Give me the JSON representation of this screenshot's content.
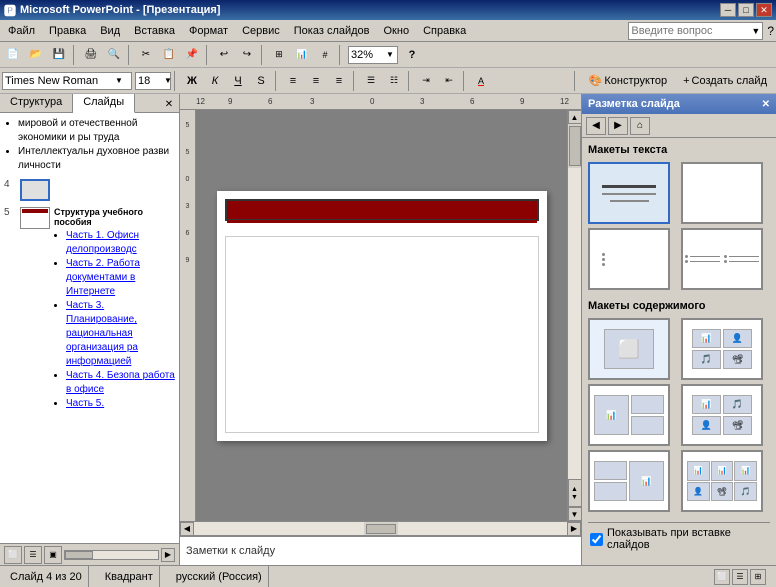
{
  "titlebar": {
    "title": "Microsoft PowerPoint - [Презентация]",
    "icon": "▶",
    "min": "─",
    "max": "□",
    "close": "✕"
  },
  "menubar": {
    "items": [
      "Файл",
      "Правка",
      "Вид",
      "Вставка",
      "Формат",
      "Сервис",
      "Показ слайдов",
      "Окно",
      "Справка"
    ],
    "search_placeholder": "Введите вопрос"
  },
  "formatting_toolbar": {
    "font": "Times New Roman",
    "size": "18",
    "bold": "Ж",
    "italic": "К",
    "underline": "Ч",
    "shadow": "S",
    "align_left": "≡",
    "align_center": "≡",
    "align_right": "≡",
    "design_label": "Конструктор",
    "new_slide_label": "Создать слайд"
  },
  "sidebar": {
    "tab_structure": "Структура",
    "tab_slides": "Слайды",
    "slides": [
      {
        "num": "4",
        "text": ""
      },
      {
        "num": "5",
        "text": "Структура учебного пособия"
      }
    ],
    "content_items": [
      "мировой и отечественной экономики и ры труда",
      "Интеллектуальн духовное разви личности"
    ],
    "bullet_items": [
      "Часть 1. Офисн делопроизводс",
      "Часть 2. Работа документами в Интернете",
      "Часть 3. Планирование, рациональная организация ра информацией",
      "Часть 4. Безопа работа в офисе",
      "Часть 5."
    ]
  },
  "canvas": {
    "zoom": "32%",
    "notes_placeholder": "Заметки к слайду"
  },
  "right_panel": {
    "title": "Разметка слайда",
    "nav_back": "◀",
    "nav_forward": "▶",
    "nav_home": "⌂",
    "section_text": "Макеты текста",
    "section_content": "Макеты содержимого",
    "checkbox_label": "Показывать при вставке слайдов"
  },
  "statusbar": {
    "slide_info": "Слайд 4 из 20",
    "location": "Квадрант",
    "language": "русский (Россия)"
  }
}
